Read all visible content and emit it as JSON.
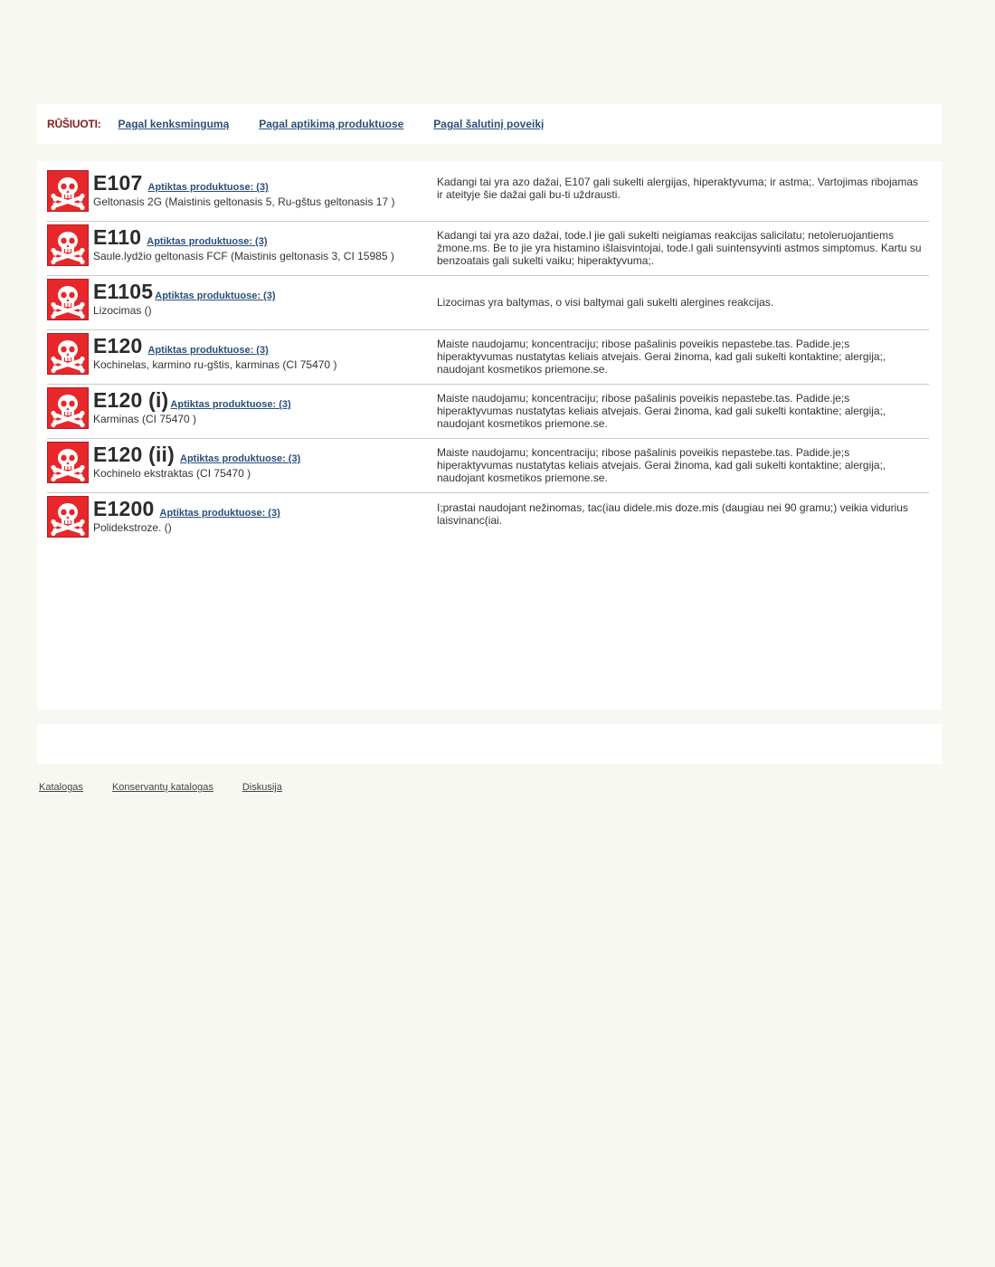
{
  "sort": {
    "label": "RŪŠIUOTI:",
    "links": [
      "Pagal kenksmingumą",
      "Pagal aptikimą produktuose",
      "Pagal šalutinį poveikį"
    ]
  },
  "colors": {
    "icon_red": "#e8272a",
    "link_blue": "#2a4f7a",
    "label_red": "#8b1a1a"
  },
  "icon_name": "skull-crossbones-icon",
  "items": [
    {
      "code": "E107",
      "found": "Aptiktas produktuose: (3)",
      "name": "Geltonasis 2G (Maistinis geltonasis 5, Ru-gštus geltonasis 17 )",
      "desc": "Kadangi tai yra azo dažai, E107 gali sukelti alergijas, hiperaktyvuma; ir astma;. Vartojimas ribojamas ir ateityje šie dažai gali bu-ti uždrausti."
    },
    {
      "code": "E110",
      "found": "Aptiktas produktuose: (3)",
      "name": "Saule.lydžio geltonasis FCF (Maistinis geltonasis 3, CI 15985 )",
      "desc": "Kadangi tai yra azo dažai, tode.l jie gali sukelti neigiamas reakcijas salicilatu; netoleruojantiems žmone.ms. Be to jie yra histamino išlaisvintojai, tode.l gali suintensyvinti astmos simptomus. Kartu su benzoatais gali sukelti vaiku; hiperaktyvuma;."
    },
    {
      "code": "E1105",
      "found": "Aptiktas produktuose: (3)",
      "name": "Lizocimas ()",
      "desc": "Lizocimas yra baltymas, o visi baltymai gali sukelti alergines reakcijas."
    },
    {
      "code": "E120",
      "found": "Aptiktas produktuose: (3)",
      "name": "Kochinelas, karmino ru-gštis, karminas (CI 75470 )",
      "desc": "Maiste naudojamu; koncentraciju; ribose pašalinis poveikis nepastebe.tas. Padide.je;s hiperaktyvumas nustatytas keliais atvejais. Gerai žinoma, kad gali sukelti kontaktine; alergija;, naudojant kosmetikos priemone.se."
    },
    {
      "code": "E120 (i)",
      "found": "Aptiktas produktuose: (3)",
      "name": "Karminas (CI 75470 )",
      "desc": "Maiste naudojamu; koncentraciju; ribose pašalinis poveikis nepastebe.tas. Padide.je;s hiperaktyvumas nustatytas keliais atvejais. Gerai žinoma, kad gali sukelti kontaktine; alergija;, naudojant kosmetikos priemone.se."
    },
    {
      "code": "E120 (ii)",
      "found": "Aptiktas produktuose: (3)",
      "name": "Kochinelo ekstraktas (CI 75470 )",
      "desc": "Maiste naudojamu; koncentraciju; ribose pašalinis poveikis nepastebe.tas. Padide.je;s hiperaktyvumas nustatytas keliais atvejais. Gerai žinoma, kad gali sukelti kontaktine; alergija;, naudojant kosmetikos priemone.se."
    },
    {
      "code": "E1200",
      "found": "Aptiktas produktuose: (3)",
      "name": "Polidekstroze. ()",
      "desc": "I;prastai naudojant nežinomas, tac(iau didele.mis doze.mis (daugiau nei 90 gramu;) veikia vidurius laisvinanc(iai."
    }
  ],
  "footer": {
    "links": [
      "Katalogas",
      "Konservantų katalogas",
      "Diskusija"
    ]
  }
}
